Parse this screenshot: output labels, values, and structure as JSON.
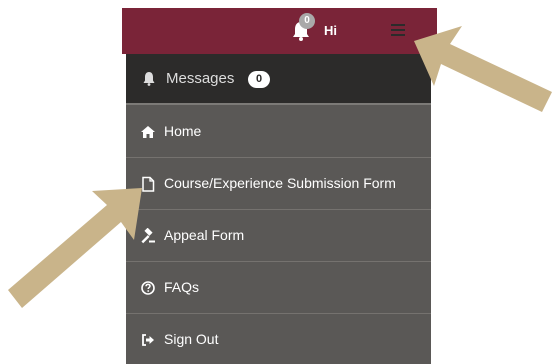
{
  "header": {
    "notification_count": "0",
    "greeting": "Hi"
  },
  "menu": {
    "messages": {
      "label": "Messages",
      "count": "0",
      "icon": "bell-icon"
    },
    "items": [
      {
        "label": "Home",
        "icon": "home-icon"
      },
      {
        "label": "Course/Experience Submission Form",
        "icon": "document-icon"
      },
      {
        "label": "Appeal Form",
        "icon": "gavel-icon"
      },
      {
        "label": "FAQs",
        "icon": "question-circle-icon"
      },
      {
        "label": "Sign Out",
        "icon": "sign-out-icon"
      }
    ]
  },
  "colors": {
    "header_bg": "#7a2438",
    "menu_bg": "#5a5856",
    "messages_bg": "#2c2b2a",
    "arrow": "#c9b48a"
  }
}
